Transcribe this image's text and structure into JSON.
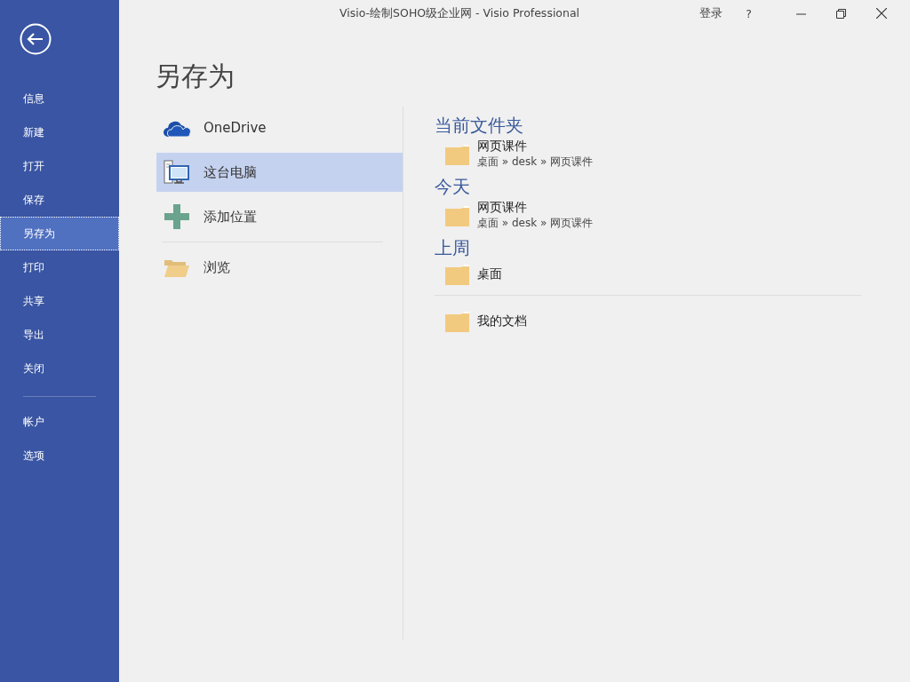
{
  "window": {
    "title": "Visio-绘制SOHO级企业网 - Visio Professional",
    "signin": "登录",
    "help": "?"
  },
  "nav": [
    {
      "label": "信息",
      "selected": false
    },
    {
      "label": "新建",
      "selected": false
    },
    {
      "label": "打开",
      "selected": false
    },
    {
      "label": "保存",
      "selected": false
    },
    {
      "label": "另存为",
      "selected": true
    },
    {
      "label": "打印",
      "selected": false
    },
    {
      "label": "共享",
      "selected": false
    },
    {
      "label": "导出",
      "selected": false
    },
    {
      "label": "关闭",
      "selected": false
    }
  ],
  "nav_bottom": [
    {
      "label": "帐户",
      "selected": false
    },
    {
      "label": "选项",
      "selected": false
    }
  ],
  "page_title": "另存为",
  "locations": [
    {
      "kind": "onedrive",
      "label": "OneDrive",
      "selected": false
    },
    {
      "kind": "pc",
      "label": "这台电脑",
      "selected": true
    },
    {
      "kind": "add",
      "label": "添加位置",
      "selected": false
    }
  ],
  "locations_bottom": [
    {
      "kind": "browse",
      "label": "浏览",
      "selected": false
    }
  ],
  "sections": [
    {
      "heading": "当前文件夹",
      "folders": [
        {
          "name": "网页课件",
          "path": "桌面 » desk » 网页课件"
        }
      ]
    },
    {
      "heading": "今天",
      "folders": [
        {
          "name": "网页课件",
          "path": "桌面 » desk » 网页课件"
        }
      ]
    },
    {
      "heading": "上周",
      "folders": [
        {
          "name": "桌面"
        }
      ]
    }
  ],
  "folders_bottom": [
    {
      "name": "我的文档"
    }
  ]
}
